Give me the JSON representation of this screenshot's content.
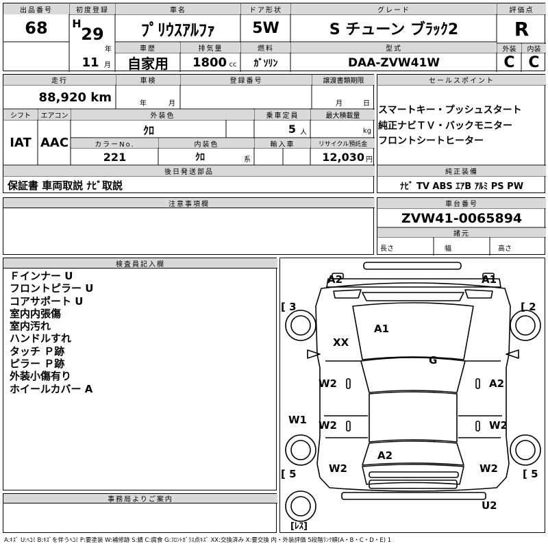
{
  "header_labels": {
    "lot_number": "出品番号",
    "first_registration": "初度登録",
    "car_name": "車名",
    "door_type": "ドア形状",
    "grade": "グレード",
    "score": "評価点",
    "history": "車歴",
    "displacement": "排気量",
    "fuel": "燃料",
    "model_code": "型式",
    "exterior": "外装",
    "interior": "内装"
  },
  "vehicle": {
    "lot_number": "68",
    "era": "H",
    "year": "29",
    "year_unit": "年",
    "month": "11",
    "month_unit": "月",
    "car_name": "ﾌﾟﾘｳｽｱﾙﾌｧ",
    "door_type": "5W",
    "grade": "S チューン ブﾗｯｸ2",
    "score": "R",
    "history": "自家用",
    "displacement": "1800",
    "displacement_unit": "cc",
    "fuel": "ｶﾞｿﾘﾝ",
    "model_code": "DAA-ZVW41W",
    "exterior_grade": "C",
    "interior_grade": "C"
  },
  "detail_labels": {
    "mileage": "走行",
    "inspection": "車検",
    "registration_number": "登録番号",
    "transfer_deadline": "譲渡書類期限",
    "sales_points": "セールスポイント",
    "shift": "シフト",
    "aircon": "エアコン",
    "exterior_color": "外装色",
    "capacity": "乗車定員",
    "max_load": "最大積載量",
    "color_no": "カラーNo.",
    "interior_color": "内装色",
    "import": "輸入車",
    "recycle_fee": "リサイクル預託金",
    "later_items": "後日発送部品",
    "genuine_equipment": "純正装備",
    "notes": "注意事項欄",
    "chassis_number": "車台番号",
    "specs": "諸元",
    "length": "長さ",
    "width": "幅",
    "height": "高さ",
    "inspector_notes": "検査員記入欄",
    "office_notes": "事務局よりご案内"
  },
  "details": {
    "mileage": "88,920 km",
    "inspection_year_unit": "年",
    "inspection_month_unit": "月",
    "transfer_month_unit": "月",
    "transfer_day_unit": "日",
    "shift": "IAT",
    "aircon": "AAC",
    "exterior_color": "ｸﾛ",
    "capacity": "5",
    "capacity_unit": "人",
    "max_load_unit": "kg",
    "color_no": "221",
    "interior_color": "ｸﾛ",
    "interior_color_suffix": "系",
    "recycle_fee": "12,030",
    "recycle_fee_unit": "円",
    "later_items": "保証書 車両取説 ﾅﾋﾞ取説",
    "genuine_equipment": "ﾅﾋﾞ  TV  ABS  ｴｱB  ｱﾙﾐ  PS  PW",
    "chassis_number": "ZVW41-0065894"
  },
  "sales_points": [
    "スマートキー・プッシュスタート",
    "純正ナビＴＶ・バックモニター",
    "フロントシートヒーター"
  ],
  "inspector_notes": [
    "Ｆインナー U",
    "フロントピラー U",
    "コアサポート U",
    "室内内張傷",
    "室内汚れ",
    "ハンドルすれ",
    "タッチ Ｐ跡",
    "ピラー Ｐ跡",
    "外装小傷有り",
    "ホイールカバー A"
  ],
  "diagram": {
    "a2_top_left": "A2",
    "a1_top_right": "A1",
    "num_3": "[ 3",
    "num_2": "[ 2",
    "xx": "XX",
    "a1_hood": "A1",
    "g_windshield": "G",
    "w2_left_front_door": "W2",
    "a2_right_front_door": "A2",
    "w1_left_side": "W1",
    "w2_left_rear_door": "W2",
    "w2_right_rear_door": "W2",
    "a2_roof": "A2",
    "w2_left_rear": "W2",
    "w2_right_rear": "W2",
    "num_5_left": "[ 5",
    "num_5_right": "[ 5",
    "u2_rear": "U2",
    "spare_label": "[ﾚｽ]"
  },
  "legend": "A:ｷｽﾞ  U:ﾍｺﾐ  B:ｷｽﾞを伴うﾍｺﾐ  P:要塗装  W:補修跡  S:錆  C:腐食  G:ﾌﾛﾝﾄｶﾞﾗｽ点ｷｽﾞ  XX:交換済み  X:要交換   内・外装評価  5段階ﾗﾝｸ順(A・B・C・D・E) 1"
}
